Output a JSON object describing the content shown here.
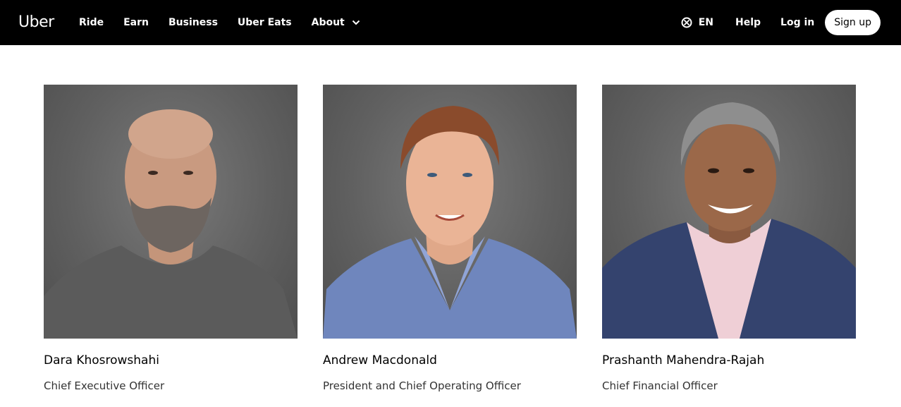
{
  "header": {
    "logo": "Uber",
    "nav": [
      "Ride",
      "Earn",
      "Business",
      "Uber Eats",
      "About"
    ],
    "language": "EN",
    "help": "Help",
    "login": "Log in",
    "signup": "Sign up",
    "icons": {
      "language": "globe-icon",
      "about_menu": "chevron-down-icon"
    }
  },
  "leaders": [
    {
      "name": "Dara Khosrowshahi",
      "title": "Chief Executive Officer"
    },
    {
      "name": "Andrew Macdonald",
      "title": "President and Chief Operating Officer"
    },
    {
      "name": "Prashanth Mahendra-Rajah",
      "title": "Chief Financial Officer"
    }
  ],
  "colors": {
    "topbar": "#000000",
    "background": "#ffffff",
    "photo_background": "#6b6b6b"
  }
}
